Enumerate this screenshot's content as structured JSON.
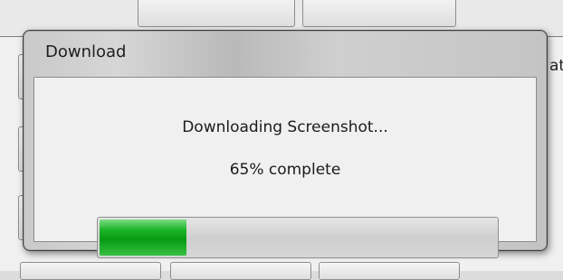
{
  "dialog": {
    "title": "Download",
    "status": "Downloading Screenshot...",
    "percent_label": "65% complete"
  },
  "progress": {
    "displayed_fill_fraction": 0.22
  },
  "background": {
    "cut_text": "ati"
  },
  "colors": {
    "progress_green": "#069a13",
    "dialog_client": "#f0f0f0",
    "progress_track": "#d6d6d6"
  }
}
